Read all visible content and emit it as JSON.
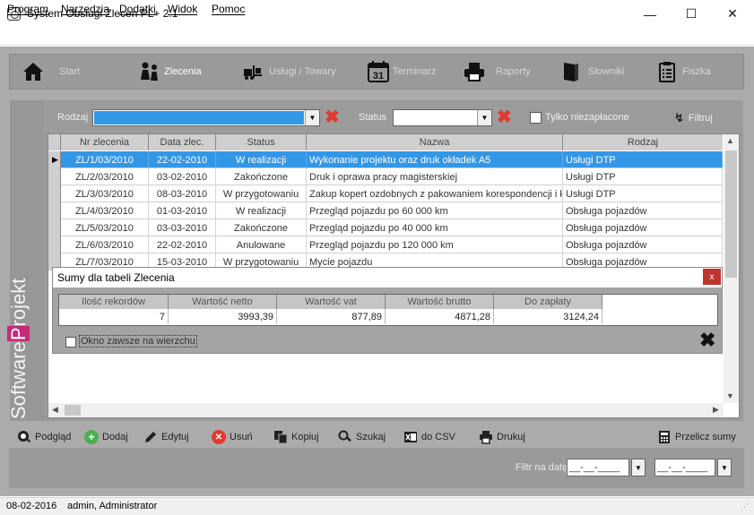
{
  "window": {
    "title": "System Obslugi Zlecen PL+ 2.1",
    "minimize": "—",
    "maximize": "☐",
    "close": "✕"
  },
  "menu": [
    "Program",
    "Narzędzia",
    "Dodatki",
    "Widok",
    "Pomoc"
  ],
  "nav": [
    {
      "label": "Start",
      "icon": "home-icon",
      "active": false
    },
    {
      "label": "Zlecenia",
      "icon": "people-icon",
      "active": true
    },
    {
      "label": "Usługi / Towary",
      "icon": "forklift-icon",
      "active": false
    },
    {
      "label": "Terminarz",
      "icon": "calendar-icon",
      "active": false
    },
    {
      "label": "Raporty",
      "icon": "printer-icon",
      "active": false
    },
    {
      "label": "Słowniki",
      "icon": "book-icon",
      "active": false
    },
    {
      "label": "Fiszka",
      "icon": "clipboard-icon",
      "active": false
    }
  ],
  "calendar_icon_day": "31",
  "sidebar_logo": {
    "part1": "Software",
    "part2": "P",
    "part3": "rojekt"
  },
  "filters": {
    "rodzaj_label": "Rodzaj",
    "rodzaj_value": "",
    "status_label": "Status",
    "status_value": "",
    "unpaid_label": "Tylko niezapłacone",
    "filter_button": "Filtruj"
  },
  "grid": {
    "columns": [
      "Nr zlecenia",
      "Data zlec.",
      "Status",
      "Nazwa",
      "Rodzaj"
    ],
    "rows": [
      [
        "ZL/1/03/2010",
        "22-02-2010",
        "W realizacji",
        "Wykonanie projektu oraz druk okładek A5",
        "Usługi DTP"
      ],
      [
        "ZL/2/03/2010",
        "03-02-2010",
        "Zakończone",
        "Druk i oprawa pracy magisterskiej",
        "Usługi DTP"
      ],
      [
        "ZL/3/03/2010",
        "08-03-2010",
        "W przygotowaniu",
        "Zakup kopert ozdobnych z pakowaniem korespondencji i k",
        "Usługi DTP"
      ],
      [
        "ZL/4/03/2010",
        "01-03-2010",
        "W realizacji",
        "Przegląd pojazdu po 60 000 km",
        "Obsługa pojazdów"
      ],
      [
        "ZL/5/03/2010",
        "03-03-2010",
        "Zakończone",
        "Przegląd pojazdu po 40 000 km",
        "Obsługa pojazdów"
      ],
      [
        "ZL/6/03/2010",
        "22-02-2010",
        "Anulowane",
        "Przegląd pojazdu po 120 000 km",
        "Obsługa pojazdów"
      ],
      [
        "ZL/7/03/2010",
        "15-03-2010",
        "W przygotowaniu",
        "Mycie pojazdu",
        "Obsługa pojazdów"
      ]
    ],
    "selected_row": 0
  },
  "sums": {
    "title": "Sumy dla tabeli Zlecenia",
    "close": "x",
    "columns": [
      "Ilość rekordów",
      "Wartość netto",
      "Wartość vat",
      "Wartość brutto",
      "Do zapłaty"
    ],
    "values": [
      "7",
      "3993,39",
      "877,89",
      "4871,28",
      "3124,24"
    ],
    "always_on_top_label": "Okno zawsze na wierzchu",
    "close_big": "✖"
  },
  "toolbar": [
    {
      "label": "Podgląd",
      "icon": "magnifier-icon"
    },
    {
      "label": "Dodaj",
      "icon": "plus-icon"
    },
    {
      "label": "Edytuj",
      "icon": "pencil-icon"
    },
    {
      "label": "Usuń",
      "icon": "delete-icon"
    },
    {
      "label": "Kopiuj",
      "icon": "copy-icon"
    },
    {
      "label": "Szukaj",
      "icon": "search-icon"
    },
    {
      "label": "do CSV",
      "icon": "excel-icon"
    },
    {
      "label": "Drukuj",
      "icon": "print-icon"
    },
    {
      "label": "Przelicz sumy",
      "icon": "calculator-icon"
    }
  ],
  "date_filter": {
    "label": "Filtr na datę",
    "from": "__-__-____",
    "to": "__-__-____"
  },
  "status": {
    "date": "08-02-2016",
    "user": "admin, Administrator"
  },
  "colors": {
    "selection": "#3397e8",
    "panel": "#ababab",
    "red_x": "#e23a2e",
    "logo_accent": "#c42b78"
  }
}
